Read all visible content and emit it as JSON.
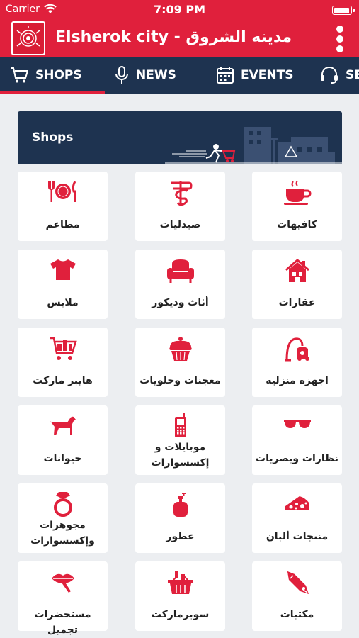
{
  "status_bar": {
    "carrier": "Carrier",
    "time": "7:09 PM",
    "battery_level": 0.95
  },
  "app_bar": {
    "title": "Elsherok city - مدينه الشروق",
    "logo": "city-logo-icon",
    "menu_icon": "more-vertical-icon"
  },
  "tabs": [
    {
      "label": "SHOPS",
      "icon": "cart-icon",
      "selected": true
    },
    {
      "label": "NEWS",
      "icon": "microphone-icon"
    },
    {
      "label": "EVENTS",
      "icon": "calendar-icon"
    },
    {
      "label": "SE",
      "icon": "headset-icon"
    }
  ],
  "banner": {
    "title": "Shops"
  },
  "accent_color": "#e0203c",
  "header_color": "#1e3350",
  "categories": [
    {
      "label": "كافيهات",
      "icon": "coffee-cup-icon"
    },
    {
      "label": "صيدليات",
      "icon": "pharmacy-icon"
    },
    {
      "label": "مطاعم",
      "icon": "restaurant-icon"
    },
    {
      "label": "عقارات",
      "icon": "house-icon"
    },
    {
      "label": "أثاث وديكور",
      "icon": "armchair-icon"
    },
    {
      "label": "ملابس",
      "icon": "tshirt-icon"
    },
    {
      "label": "اجهزة منزلية",
      "icon": "vacuum-icon"
    },
    {
      "label": "معجنات وحلويات",
      "icon": "cupcake-icon"
    },
    {
      "label": "هايبر ماركت",
      "icon": "shopping-cart-icon"
    },
    {
      "label": "نظارات وبصريات",
      "icon": "sunglasses-icon"
    },
    {
      "label": "موبايلات و إكسسوارات",
      "icon": "mobile-phone-icon"
    },
    {
      "label": "حيوانات",
      "icon": "dog-icon"
    },
    {
      "label": "منتجات ألبان",
      "icon": "cheese-icon"
    },
    {
      "label": "عطور",
      "icon": "perfume-icon"
    },
    {
      "label": "مجوهرات وإكسسوارات",
      "icon": "ring-icon"
    },
    {
      "label": "مكتبات",
      "icon": "pen-nib-icon"
    },
    {
      "label": "سوبرماركت",
      "icon": "basket-icon"
    },
    {
      "label": "مستحضرات تجميل",
      "icon": "lipstick-icon"
    }
  ]
}
